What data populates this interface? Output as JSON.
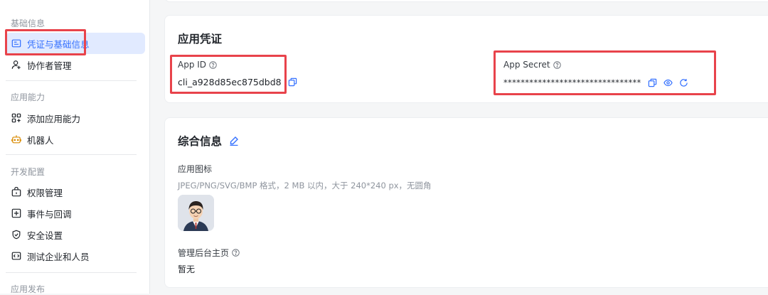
{
  "sidebar": {
    "groups": [
      {
        "title": "基础信息",
        "items": [
          {
            "label": "凭证与基础信息",
            "icon": "credential-icon",
            "active": true
          },
          {
            "label": "协作者管理",
            "icon": "collaborator-icon"
          }
        ]
      },
      {
        "title": "应用能力",
        "items": [
          {
            "label": "添加应用能力",
            "icon": "add-capability-icon"
          },
          {
            "label": "机器人",
            "icon": "robot-icon"
          }
        ]
      },
      {
        "title": "开发配置",
        "items": [
          {
            "label": "权限管理",
            "icon": "permission-icon"
          },
          {
            "label": "事件与回调",
            "icon": "event-icon"
          },
          {
            "label": "安全设置",
            "icon": "shield-icon"
          },
          {
            "label": "测试企业和人员",
            "icon": "test-org-icon"
          }
        ]
      },
      {
        "title": "应用发布",
        "items": []
      }
    ]
  },
  "credentials": {
    "title": "应用凭证",
    "app_id_label": "App ID",
    "app_id_value": "cli_a928d85ec875dbd8",
    "app_secret_label": "App Secret",
    "app_secret_value": "********************************"
  },
  "general": {
    "title": "综合信息",
    "icon_label": "应用图标",
    "icon_hint": "JPEG/PNG/SVG/BMP 格式，2 MB 以内，大于 240*240 px，无圆角",
    "homepage_label": "管理后台主页",
    "homepage_value": "暂无"
  },
  "colors": {
    "accent": "#3370ff",
    "highlight": "#e8434b",
    "active_bg": "#e1eaff",
    "robot": "#d98a00"
  }
}
